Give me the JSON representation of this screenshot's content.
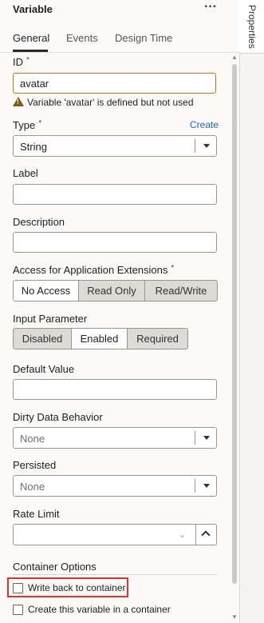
{
  "panel": {
    "title": "Variable",
    "more_icon": "more-horizontal-icon"
  },
  "side_tab": {
    "label": "Properties"
  },
  "tabs": [
    {
      "label": "General",
      "active": true
    },
    {
      "label": "Events",
      "active": false
    },
    {
      "label": "Design Time",
      "active": false
    }
  ],
  "id_field": {
    "label": "ID",
    "required_mark": "*",
    "value": "avatar",
    "warning": "Variable 'avatar' is defined but not used"
  },
  "type_field": {
    "label": "Type",
    "required_mark": "*",
    "create_link": "Create",
    "value": "String"
  },
  "label_field": {
    "label": "Label",
    "value": ""
  },
  "description_field": {
    "label": "Description",
    "value": ""
  },
  "access": {
    "label": "Access for Application Extensions",
    "required_mark": "*",
    "options": [
      "No Access",
      "Read Only",
      "Read/Write"
    ],
    "selected": "No Access"
  },
  "input_parameter": {
    "label": "Input Parameter",
    "options": [
      "Disabled",
      "Enabled",
      "Required"
    ],
    "selected": "Enabled"
  },
  "default_value": {
    "label": "Default Value",
    "value": ""
  },
  "dirty_data": {
    "label": "Dirty Data Behavior",
    "value": "None"
  },
  "persisted": {
    "label": "Persisted",
    "value": "None"
  },
  "rate_limit": {
    "label": "Rate Limit",
    "value": ""
  },
  "container_options": {
    "label": "Container Options",
    "write_back": {
      "label": "Write back to container",
      "checked": false
    },
    "create_in_container": {
      "label": "Create this variable in a container",
      "checked": false
    }
  },
  "colors": {
    "highlight": "#e0342f",
    "link": "#1e6aa6",
    "warning_border": "#b97b27"
  }
}
